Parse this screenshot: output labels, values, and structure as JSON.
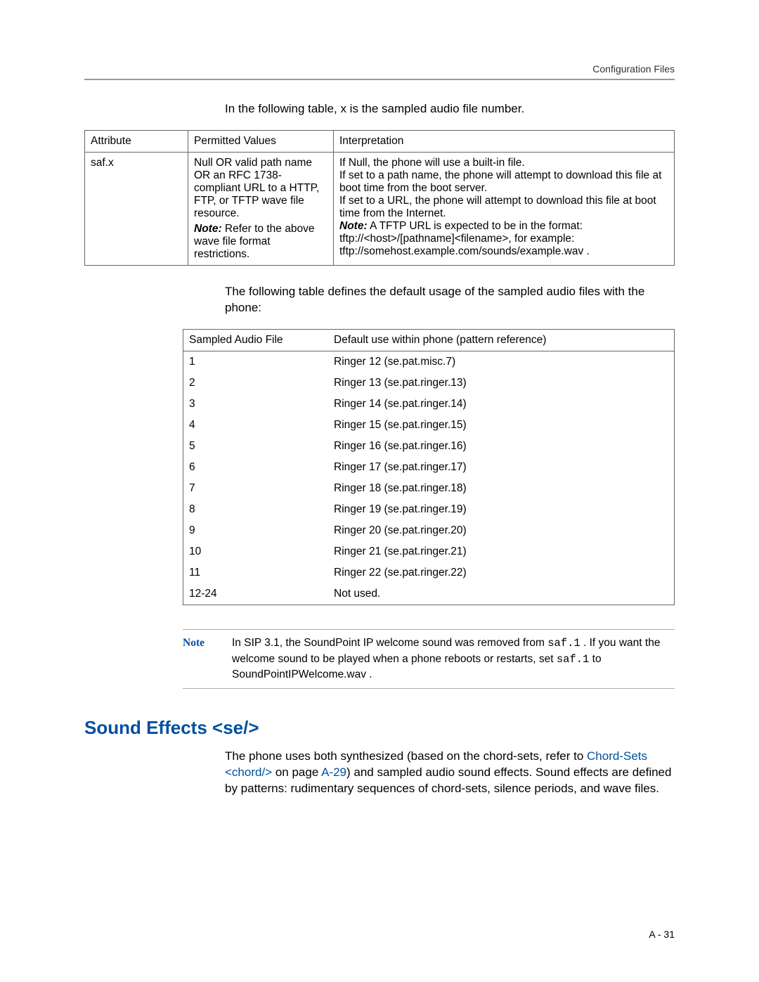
{
  "header": {
    "running_head": "Configuration Files"
  },
  "intro": {
    "table_intro": "In the following table,  x is the sampled audio file number.",
    "attr_table": {
      "cols": [
        "Attribute",
        "Permitted Values",
        "Interpretation"
      ],
      "row": {
        "attribute": "saf.x",
        "perm_main": "Null OR valid path name OR an RFC 1738-compliant URL to a HTTP, FTP, or TFTP wave file resource.",
        "perm_note_prefix": "Note:",
        "perm_note_rest": " Refer to the above wave file format restrictions.",
        "interp_l1": "If Null, the phone will use a built-in file.",
        "interp_l2": "If set to a path name, the phone will attempt to download this file at boot time from the boot server.",
        "interp_l3": "If set to a URL, the phone will attempt to download this file at boot time from the Internet.",
        "interp_note_prefix": "Note:",
        "interp_note_rest": " A TFTP URL is expected to be in the format: tftp://<host>/[pathname]<filename>, for example: tftp://somehost.example.com/sounds/example.wav ."
      }
    },
    "usage_intro": "The following table defines the default usage of the sampled audio files with the phone:",
    "saf_table": {
      "cols": [
        "Sampled Audio File",
        "Default use within phone (pattern reference)"
      ],
      "rows": [
        [
          "1",
          "Ringer 12 (se.pat.misc.7)"
        ],
        [
          "2",
          "Ringer 13 (se.pat.ringer.13)"
        ],
        [
          "3",
          "Ringer 14 (se.pat.ringer.14)"
        ],
        [
          "4",
          "Ringer 15 (se.pat.ringer.15)"
        ],
        [
          "5",
          "Ringer 16 (se.pat.ringer.16)"
        ],
        [
          "6",
          "Ringer 17 (se.pat.ringer.17)"
        ],
        [
          "7",
          "Ringer 18 (se.pat.ringer.18)"
        ],
        [
          "8",
          "Ringer 19 (se.pat.ringer.19)"
        ],
        [
          "9",
          "Ringer 20 (se.pat.ringer.20)"
        ],
        [
          "10",
          "Ringer 21 (se.pat.ringer.21)"
        ],
        [
          "11",
          "Ringer 22 (se.pat.ringer.22)"
        ],
        [
          "12-24",
          "Not used."
        ]
      ]
    }
  },
  "note": {
    "label": "Note",
    "body_pre": "In SIP 3.1, the SoundPoint IP welcome sound was removed from ",
    "code1": "saf.1",
    "body_mid": " . If you want the welcome sound to be played when a phone reboots or restarts, set ",
    "code2": "saf.1",
    "body_post": " to SoundPointIPWelcome.wav   ."
  },
  "section": {
    "heading": "Sound Effects <se/>",
    "para_pre": "The phone uses both synthesized (based on the chord-sets, refer to ",
    "link1": "Chord-Sets <chord/>",
    "para_mid1": " on page ",
    "link2": "A-29",
    "para_post": ") and sampled audio sound effects. Sound effects are defined by patterns: rudimentary sequences of chord-sets, silence periods, and wave files."
  },
  "footer": {
    "page_num": "A - 31"
  }
}
